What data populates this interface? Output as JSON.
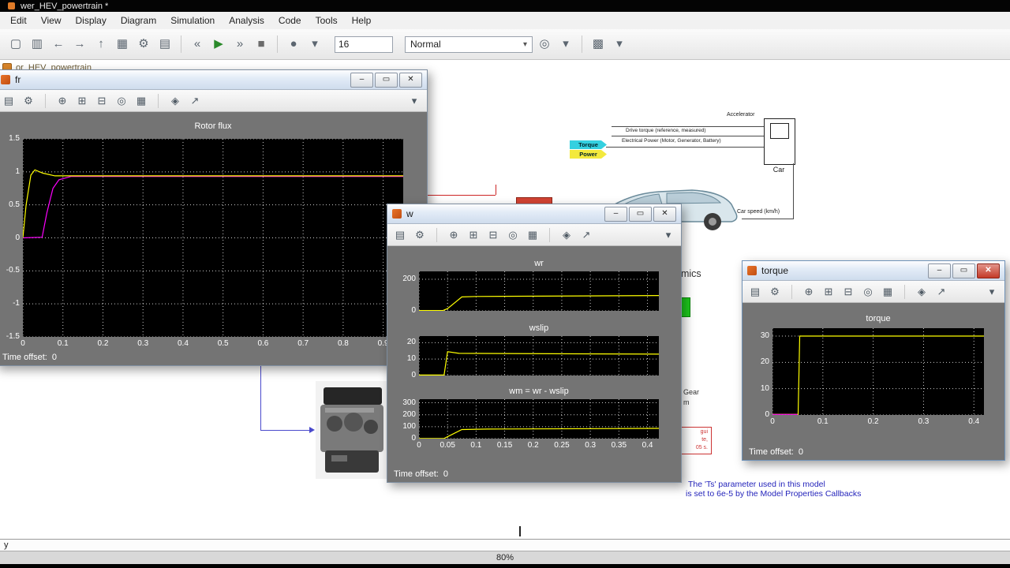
{
  "window": {
    "title_bar": "wer_HEV_powertrain *"
  },
  "menu_bar": {
    "items": [
      "Edit",
      "View",
      "Display",
      "Diagram",
      "Simulation",
      "Analysis",
      "Code",
      "Tools",
      "Help"
    ]
  },
  "toolbar": {
    "sim_stop_time": "16",
    "sim_mode": "Normal"
  },
  "breadcrumb": {
    "text": "or_HEV_powertrain"
  },
  "status_bar": {
    "left_text": "y",
    "zoom": "80%"
  },
  "window_controls": {
    "minimize": "–",
    "maximize": "▭",
    "close": "✕"
  },
  "main_toolbar": {
    "group1": [
      {
        "name": "new-model-icon",
        "glyph": "▢"
      },
      {
        "name": "save-icon",
        "glyph": "▥"
      },
      {
        "name": "back-icon",
        "glyph": "←"
      },
      {
        "name": "forward-icon",
        "glyph": "→"
      },
      {
        "name": "up-to-parent-icon",
        "glyph": "↑"
      },
      {
        "name": "library-browser-icon",
        "glyph": "▦"
      },
      {
        "name": "configuration-icon",
        "glyph": "⚙"
      },
      {
        "name": "print-icon",
        "glyph": "▤"
      },
      {
        "name": "separator"
      },
      {
        "name": "step-back-icon",
        "glyph": "«"
      },
      {
        "name": "run-icon",
        "glyph": "▶",
        "color": "#2a8a2a"
      },
      {
        "name": "step-forward-icon",
        "glyph": "»"
      },
      {
        "name": "stop-icon",
        "glyph": "■",
        "color": "#6b6b6b"
      },
      {
        "name": "separator"
      },
      {
        "name": "fast-restart-icon",
        "glyph": "●"
      },
      {
        "name": "chevron-down-icon",
        "glyph": "▾"
      }
    ],
    "group2": [
      {
        "name": "update-diagram-icon",
        "glyph": "◎"
      },
      {
        "name": "chevron-down-icon",
        "glyph": "▾"
      },
      {
        "name": "separator"
      },
      {
        "name": "build-icon",
        "glyph": "▩"
      },
      {
        "name": "chevron-down-icon",
        "glyph": "▾"
      }
    ]
  },
  "scope_toolbar": {
    "icons": [
      {
        "name": "print-icon",
        "glyph": "▤"
      },
      {
        "name": "parameters-icon",
        "glyph": "⚙"
      },
      {
        "name": "separator"
      },
      {
        "name": "zoom-icon",
        "glyph": "⊕"
      },
      {
        "name": "zoom-x-icon",
        "glyph": "⊞"
      },
      {
        "name": "zoom-y-icon",
        "glyph": "⊟"
      },
      {
        "name": "autoscale-icon",
        "glyph": "◎"
      },
      {
        "name": "save-axes-icon",
        "glyph": "▦"
      },
      {
        "name": "separator"
      },
      {
        "name": "lock-axes-icon",
        "glyph": "◈"
      },
      {
        "name": "signal-trace-icon",
        "glyph": "↗"
      }
    ],
    "dock_glyph": "▾"
  },
  "scopes": {
    "fr": {
      "window_title": "fr",
      "time_offset_label": "Time offset:",
      "time_offset_value": "0"
    },
    "w": {
      "window_title": "w",
      "time_offset_label": "Time offset:",
      "time_offset_value": "0"
    },
    "torque": {
      "window_title": "torque",
      "time_offset_label": "Time offset:",
      "time_offset_value": "0"
    }
  },
  "model": {
    "accelerator": "Accelerator",
    "car_block": "Car",
    "drive_torque": "Drive torque (reference, measured)",
    "electrical_power": "Electrical Power (Motor, Generator, Battery)",
    "car_speed": "Car speed (km/h)",
    "torque_tag": "Torque",
    "power_tag": "Power",
    "vehicle_dynamics": "Vehicle Dynamics",
    "gear_fragment": "Gear",
    "m_fragment": "m",
    "note_fragments": [
      "gui",
      "te,",
      "05 s."
    ],
    "ts_note_line1": "The 'Ts' parameter used in this model",
    "ts_note_line2": "is set to 6e-5  by the Model Properties Callbacks",
    "colors": {
      "torque_tag": "#35d0e0",
      "power_tag": "#f3e93d"
    }
  },
  "chart_data": [
    {
      "id": "fr",
      "type": "line",
      "title": "Rotor flux",
      "xlim": [
        0,
        0.95
      ],
      "ylim": [
        -1.5,
        1.5
      ],
      "xlabels": true,
      "xticks": [
        [
          "0",
          0
        ],
        [
          "0.1",
          0.1
        ],
        [
          "0.2",
          0.2
        ],
        [
          "0.3",
          0.3
        ],
        [
          "0.4",
          0.4
        ],
        [
          "0.5",
          0.5
        ],
        [
          "0.6",
          0.6
        ],
        [
          "0.7",
          0.7
        ],
        [
          "0.8",
          0.8
        ],
        [
          "0.9",
          0.9
        ]
      ],
      "yticks": [
        [
          "1.5",
          1.5
        ],
        [
          "1",
          1
        ],
        [
          "0.5",
          0.5
        ],
        [
          "0",
          0
        ],
        [
          "-0.5",
          -0.5
        ],
        [
          "-1",
          -1
        ],
        [
          "-1.5",
          -1.5
        ]
      ],
      "series": [
        {
          "name": "rotor-flux-magenta",
          "color": "#ff00ff",
          "points": [
            [
              0,
              0
            ],
            [
              0.048,
              0.01
            ],
            [
              0.06,
              0.38
            ],
            [
              0.075,
              0.75
            ],
            [
              0.09,
              0.88
            ],
            [
              0.12,
              0.93
            ],
            [
              0.95,
              0.93
            ]
          ]
        },
        {
          "name": "rotor-flux-yellow",
          "color": "#ffff00",
          "points": [
            [
              0,
              0
            ],
            [
              0.008,
              0.5
            ],
            [
              0.02,
              0.95
            ],
            [
              0.03,
              1.03
            ],
            [
              0.05,
              0.98
            ],
            [
              0.08,
              0.94
            ],
            [
              0.95,
              0.94
            ]
          ]
        }
      ]
    },
    {
      "id": "wr",
      "type": "line",
      "title": "wr",
      "xlim": [
        0,
        0.42
      ],
      "ylim": [
        0,
        250
      ],
      "xlabels": false,
      "xticks": [
        [
          "0",
          0
        ],
        [
          "0.05",
          0.05
        ],
        [
          "0.1",
          0.1
        ],
        [
          "0.15",
          0.15
        ],
        [
          "0.2",
          0.2
        ],
        [
          "0.25",
          0.25
        ],
        [
          "0.3",
          0.3
        ],
        [
          "0.35",
          0.35
        ],
        [
          "0.4",
          0.4
        ]
      ],
      "yticks": [
        [
          "200",
          200
        ],
        [
          "0",
          0
        ]
      ],
      "series": [
        {
          "name": "wr-yellow",
          "color": "#ffff00",
          "points": [
            [
              0,
              2
            ],
            [
              0.042,
              2
            ],
            [
              0.05,
              14
            ],
            [
              0.075,
              88
            ],
            [
              0.1,
              91
            ],
            [
              0.42,
              97
            ]
          ]
        }
      ]
    },
    {
      "id": "wslip",
      "type": "line",
      "title": "wslip",
      "xlim": [
        0,
        0.42
      ],
      "ylim": [
        0,
        24
      ],
      "xlabels": false,
      "xticks": [
        [
          "0",
          0
        ],
        [
          "0.05",
          0.05
        ],
        [
          "0.1",
          0.1
        ],
        [
          "0.15",
          0.15
        ],
        [
          "0.2",
          0.2
        ],
        [
          "0.25",
          0.25
        ],
        [
          "0.3",
          0.3
        ],
        [
          "0.35",
          0.35
        ],
        [
          "0.4",
          0.4
        ]
      ],
      "yticks": [
        [
          "20",
          20
        ],
        [
          "10",
          10
        ],
        [
          "0",
          0
        ]
      ],
      "series": [
        {
          "name": "wslip-yellow",
          "color": "#ffff00",
          "points": [
            [
              0,
              0.3
            ],
            [
              0.044,
              0.3
            ],
            [
              0.05,
              14.5
            ],
            [
              0.07,
              13.5
            ],
            [
              0.42,
              13
            ]
          ]
        }
      ]
    },
    {
      "id": "wm",
      "type": "line",
      "title": "wm = wr - wslip",
      "xlim": [
        0,
        0.42
      ],
      "ylim": [
        0,
        330
      ],
      "xlabels": true,
      "xticks": [
        [
          "0",
          0
        ],
        [
          "0.05",
          0.05
        ],
        [
          "0.1",
          0.1
        ],
        [
          "0.15",
          0.15
        ],
        [
          "0.2",
          0.2
        ],
        [
          "0.25",
          0.25
        ],
        [
          "0.3",
          0.3
        ],
        [
          "0.35",
          0.35
        ],
        [
          "0.4",
          0.4
        ]
      ],
      "yticks": [
        [
          "300",
          300
        ],
        [
          "200",
          200
        ],
        [
          "100",
          100
        ],
        [
          "0",
          0
        ]
      ],
      "series": [
        {
          "name": "wm-yellow",
          "color": "#ffff00",
          "points": [
            [
              0,
              1
            ],
            [
              0.044,
              1
            ],
            [
              0.075,
              76
            ],
            [
              0.12,
              80
            ],
            [
              0.42,
              86
            ]
          ]
        }
      ]
    },
    {
      "id": "torque",
      "type": "line",
      "title": "torque",
      "xlim": [
        0,
        0.42
      ],
      "ylim": [
        0,
        33
      ],
      "xlabels": true,
      "xticks": [
        [
          "0",
          0
        ],
        [
          "0.1",
          0.1
        ],
        [
          "0.2",
          0.2
        ],
        [
          "0.3",
          0.3
        ],
        [
          "0.4",
          0.4
        ]
      ],
      "yticks": [
        [
          "30",
          30
        ],
        [
          "20",
          20
        ],
        [
          "10",
          10
        ],
        [
          "0",
          0
        ]
      ],
      "series": [
        {
          "name": "torque-yellow",
          "color": "#ffff00",
          "points": [
            [
              0,
              0.25
            ],
            [
              0.051,
              0.25
            ],
            [
              0.054,
              30
            ],
            [
              0.42,
              30
            ]
          ]
        },
        {
          "name": "torque-magenta",
          "color": "#ff00ff",
          "points": [
            [
              0,
              0.2
            ],
            [
              0.05,
              0.2
            ]
          ]
        }
      ]
    }
  ]
}
